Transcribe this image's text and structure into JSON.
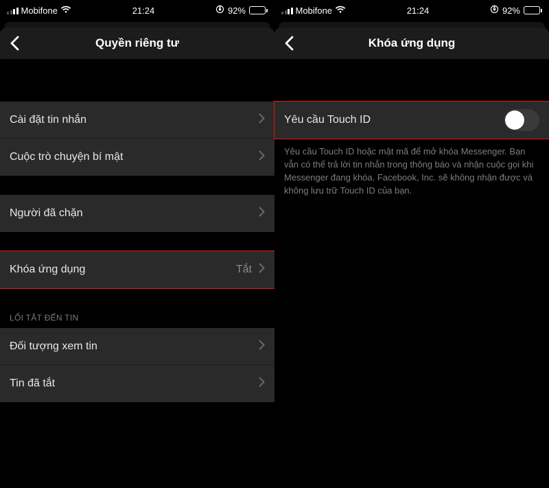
{
  "status": {
    "carrier": "Mobifone",
    "time": "21:24",
    "battery_pct": "92%"
  },
  "left": {
    "title": "Quyền riêng tư",
    "rows": {
      "msg_settings": "Cài đặt tin nhắn",
      "secret_conv": "Cuộc trò chuyện bí mật",
      "blocked": "Người đã chặn",
      "app_lock": "Khóa ứng dụng",
      "app_lock_value": "Tắt"
    },
    "section_shortcut": "LỐI TẮT ĐẾN TIN",
    "rows2": {
      "story_audience": "Đối tượng xem tin",
      "stories_off": "Tin đã tắt"
    }
  },
  "right": {
    "title": "Khóa ứng dụng",
    "row_touchid": "Yêu cầu Touch ID",
    "desc": "Yêu cầu Touch ID hoặc mật mã để mở khóa Messenger. Bạn vẫn có thể trả lời tin nhắn trong thông báo và nhận cuộc gọi khi Messenger đang khóa. Facebook, Inc. sẽ không nhận được và không lưu trữ Touch ID của bạn."
  }
}
